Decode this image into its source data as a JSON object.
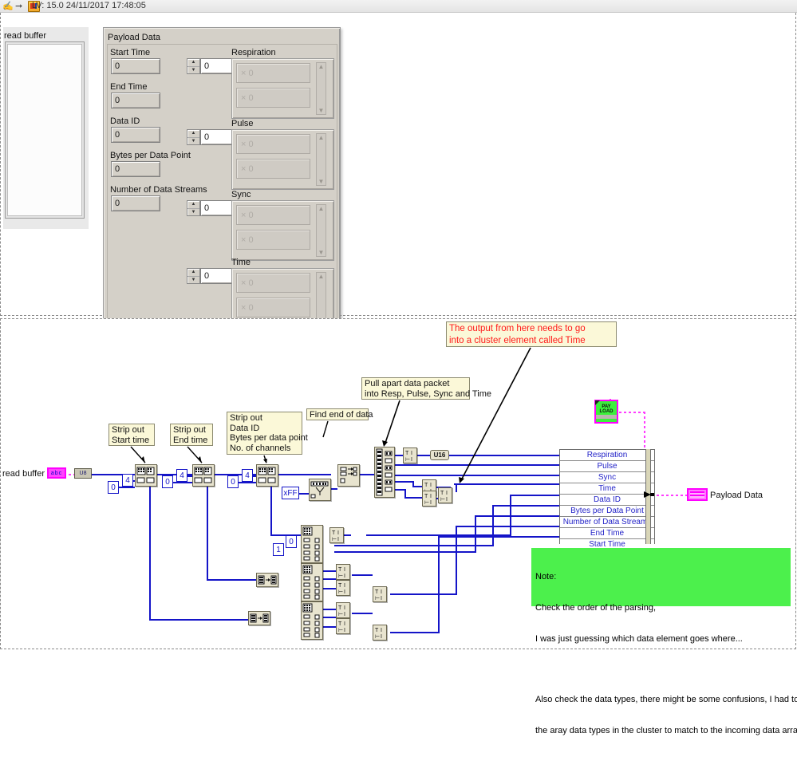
{
  "titlebar": {
    "icons": [
      "hand-icon",
      "arrow-icon",
      "labview-icon"
    ],
    "text": "LV: 15.0 24/11/2017 17:48:05"
  },
  "front_panel": {
    "read_buffer": {
      "label": "read buffer",
      "value": ""
    },
    "cluster": {
      "title": "Payload Data",
      "numeric_fields": [
        {
          "label": "Start Time",
          "value": "0"
        },
        {
          "label": "End Time",
          "value": "0"
        },
        {
          "label": "Data ID",
          "value": "0"
        },
        {
          "label": "Bytes per Data Point",
          "value": "0"
        },
        {
          "label": "Number of Data Streams",
          "value": "0"
        }
      ],
      "arrays": [
        {
          "label": "Respiration",
          "index": "0",
          "elements": [
            "0",
            "0"
          ]
        },
        {
          "label": "Pulse",
          "index": "0",
          "elements": [
            "0",
            "0"
          ]
        },
        {
          "label": "Sync",
          "index": "0",
          "elements": [
            "0",
            "0"
          ]
        },
        {
          "label": "Time",
          "index": "0",
          "elements": [
            "0",
            "0"
          ]
        }
      ]
    }
  },
  "block_diagram": {
    "terminals": {
      "read_buffer_label": "read buffer",
      "read_buffer_type": "abc",
      "payload_data_label": "Payload Data",
      "payload_icon_line1": "PAY",
      "payload_icon_line2": "LOAD"
    },
    "constants": {
      "zero": "0",
      "four": "4",
      "one": "1",
      "hex_ff": "xFF",
      "u8": "U8",
      "u16": "U16"
    },
    "comments": [
      {
        "id": "strip-start-time",
        "text": "Strip out\nStart time"
      },
      {
        "id": "strip-end-time",
        "text": "Strip out\nEnd time"
      },
      {
        "id": "strip-dataid",
        "text": "Strip out\nData ID\nBytes per data point\nNo. of channels"
      },
      {
        "id": "find-end-of-data",
        "text": "Find end of data"
      },
      {
        "id": "pull-apart",
        "text": "Pull apart data packet\ninto Resp, Pulse, Sync and Time"
      },
      {
        "id": "output-time",
        "text": "The output from here needs to go\ninto a cluster element called Time"
      }
    ],
    "note": {
      "line1": "Note:",
      "line2": "Check the order of the parsing,",
      "line3": "I was just guessing which data element goes where...",
      "line4": "",
      "line5": "Also check the data types, there might be some confusions, I had to change",
      "line6": "the aray data types in the cluster to match to the incoming data array types!"
    },
    "bundle": {
      "fields": [
        "Respiration",
        "Pulse",
        "Sync",
        "Time",
        "Data ID",
        "Bytes per Data Point",
        "Number of Data Streams",
        "End Time",
        "Start Time"
      ]
    }
  },
  "colors": {
    "wire_blue": "#1414c8",
    "wire_pink": "#ff00ff",
    "note_yellow": "#fbf8d8",
    "note_green": "#4cf04c",
    "comment_red": "#ff1a1a",
    "node_tan": "#e8e4cf",
    "cluster_gray": "#d4d0c8"
  }
}
